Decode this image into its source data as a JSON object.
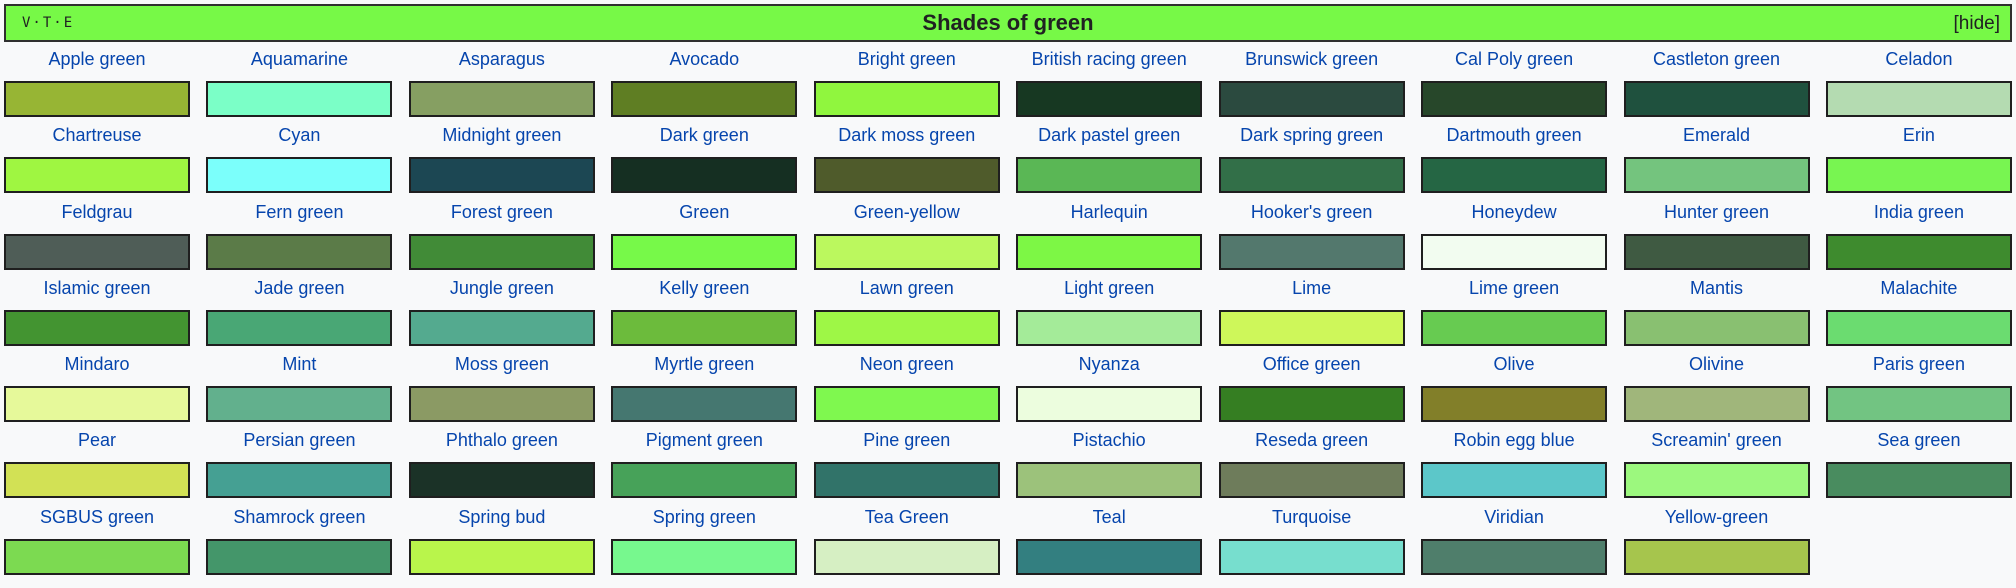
{
  "navbox": {
    "vte": "V·T·E",
    "title": "Shades of green",
    "hide": "[hide]",
    "header_color": "#77f947"
  },
  "shades": [
    {
      "name": "Apple green",
      "color": "#97b534"
    },
    {
      "name": "Aquamarine",
      "color": "#7bffc7"
    },
    {
      "name": "Asparagus",
      "color": "#869f62"
    },
    {
      "name": "Avocado",
      "color": "#5f7e23"
    },
    {
      "name": "Bright green",
      "color": "#90f63e"
    },
    {
      "name": "British racing green",
      "color": "#173822"
    },
    {
      "name": "Brunswick green",
      "color": "#2b4a3f"
    },
    {
      "name": "Cal Poly green",
      "color": "#27472a"
    },
    {
      "name": "Castleton green",
      "color": "#1f513e"
    },
    {
      "name": "Celadon",
      "color": "#b4dbb1"
    },
    {
      "name": "Chartreuse",
      "color": "#9ff641"
    },
    {
      "name": "Cyan",
      "color": "#7bfffb"
    },
    {
      "name": "Midnight green",
      "color": "#1c4753"
    },
    {
      "name": "Dark green",
      "color": "#152f22"
    },
    {
      "name": "Dark moss green",
      "color": "#4f5b2b"
    },
    {
      "name": "Dark pastel green",
      "color": "#5ab755"
    },
    {
      "name": "Dark spring green",
      "color": "#326f48"
    },
    {
      "name": "Dartmouth green",
      "color": "#256644"
    },
    {
      "name": "Emerald",
      "color": "#74c47e"
    },
    {
      "name": "Erin",
      "color": "#78f551"
    },
    {
      "name": "Feldgrau",
      "color": "#4f5d57"
    },
    {
      "name": "Fern green",
      "color": "#5b7b48"
    },
    {
      "name": "Forest green",
      "color": "#418b37"
    },
    {
      "name": "Green",
      "color": "#77f949"
    },
    {
      "name": "Green-yellow",
      "color": "#bbf85e"
    },
    {
      "name": "Harlequin",
      "color": "#7df745"
    },
    {
      "name": "Hooker's green",
      "color": "#53786d"
    },
    {
      "name": "Honeydew",
      "color": "#f2fcf0"
    },
    {
      "name": "Hunter green",
      "color": "#3f5a42"
    },
    {
      "name": "India green",
      "color": "#3e8b2e"
    },
    {
      "name": "Islamic green",
      "color": "#439431"
    },
    {
      "name": "Jade green",
      "color": "#49a775"
    },
    {
      "name": "Jungle green",
      "color": "#54aa8f"
    },
    {
      "name": "Kelly green",
      "color": "#6cbb3c"
    },
    {
      "name": "Lawn green",
      "color": "#9ef746"
    },
    {
      "name": "Light green",
      "color": "#a4eb99"
    },
    {
      "name": "Lime",
      "color": "#cef75a"
    },
    {
      "name": "Lime green",
      "color": "#67cb51"
    },
    {
      "name": "Mantis",
      "color": "#89c071"
    },
    {
      "name": "Malachite",
      "color": "#6bdc70"
    },
    {
      "name": "Mindaro",
      "color": "#e6f99a"
    },
    {
      "name": "Mint",
      "color": "#62b08d"
    },
    {
      "name": "Moss green",
      "color": "#8b9a64"
    },
    {
      "name": "Myrtle green",
      "color": "#457770"
    },
    {
      "name": "Neon green",
      "color": "#7ff84f"
    },
    {
      "name": "Nyanza",
      "color": "#ecfdde"
    },
    {
      "name": "Office green",
      "color": "#357e22"
    },
    {
      "name": "Olive",
      "color": "#827f29"
    },
    {
      "name": "Olivine",
      "color": "#a0b67b"
    },
    {
      "name": "Paris green",
      "color": "#72c482"
    },
    {
      "name": "Pear",
      "color": "#d2e155"
    },
    {
      "name": "Persian green",
      "color": "#45a093"
    },
    {
      "name": "Phthalo green",
      "color": "#1b3227"
    },
    {
      "name": "Pigment green",
      "color": "#47a259"
    },
    {
      "name": "Pine green",
      "color": "#317369"
    },
    {
      "name": "Pistachio",
      "color": "#9cc27b"
    },
    {
      "name": "Reseda green",
      "color": "#6e7c5b"
    },
    {
      "name": "Robin egg blue",
      "color": "#5cc7c9"
    },
    {
      "name": "Screamin' green",
      "color": "#9cf87e"
    },
    {
      "name": "Sea green",
      "color": "#498c5f"
    },
    {
      "name": "SGBUS green",
      "color": "#7cda51"
    },
    {
      "name": "Shamrock green",
      "color": "#44966a"
    },
    {
      "name": "Spring bud",
      "color": "#b9f54b"
    },
    {
      "name": "Spring green",
      "color": "#77f88e"
    },
    {
      "name": "Tea Green",
      "color": "#d6efc3"
    },
    {
      "name": "Teal",
      "color": "#337f80"
    },
    {
      "name": "Turquoise",
      "color": "#77dece"
    },
    {
      "name": "Viridian",
      "color": "#4f7e6b"
    },
    {
      "name": "Yellow-green",
      "color": "#a6c54d"
    }
  ]
}
